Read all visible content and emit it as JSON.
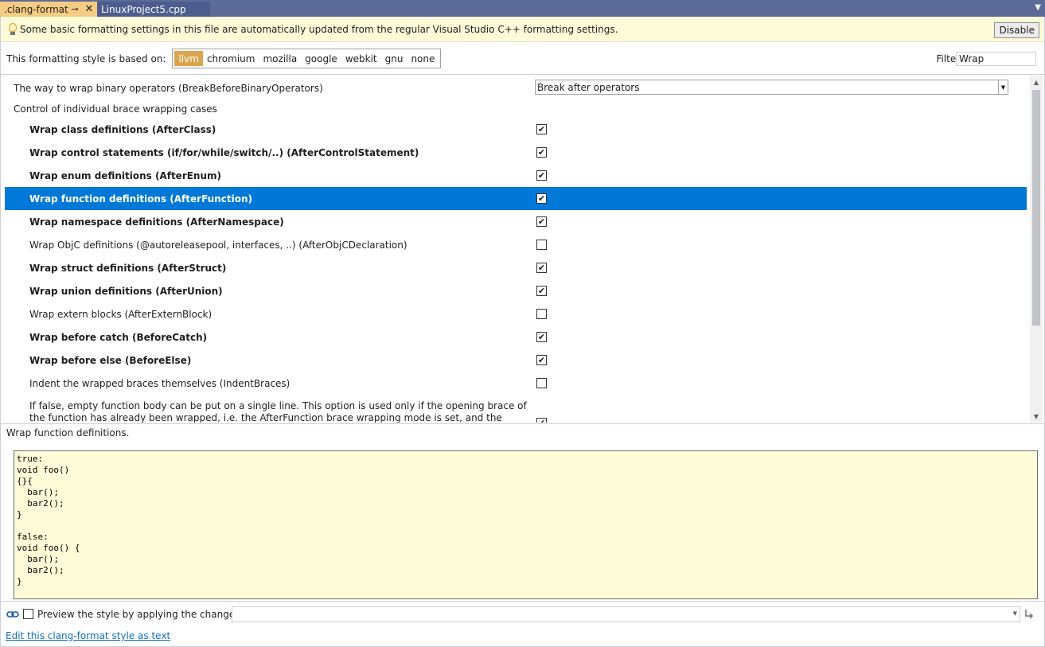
{
  "tabs": {
    "active_label": ".clang-format",
    "inactive_label": "LinuxProject5.cpp"
  },
  "infobar": {
    "message": "Some basic formatting settings in this file are automatically updated from the regular Visual Studio C++ formatting settings.",
    "disable_label": "Disable"
  },
  "basedon": {
    "label": "This formatting style is based on:",
    "styles": [
      "llvm",
      "chromium",
      "mozilla",
      "google",
      "webkit",
      "gnu",
      "none"
    ],
    "selected": "llvm",
    "filter_label": "Filter:",
    "filter_value": "Wrap"
  },
  "settings": {
    "binary_ops_label": "The way to wrap binary operators (BreakBeforeBinaryOperators)",
    "binary_ops_value": "Break after operators",
    "brace_group_label": "Control of individual brace wrapping cases",
    "items": [
      {
        "label": "Wrap class definitions (AfterClass)",
        "checked": true,
        "bold": true
      },
      {
        "label": "Wrap control statements (if/for/while/switch/..) (AfterControlStatement)",
        "checked": true,
        "bold": true
      },
      {
        "label": "Wrap enum definitions (AfterEnum)",
        "checked": true,
        "bold": true
      },
      {
        "label": "Wrap function definitions (AfterFunction)",
        "checked": true,
        "bold": true,
        "selected": true
      },
      {
        "label": "Wrap namespace definitions (AfterNamespace)",
        "checked": true,
        "bold": true
      },
      {
        "label": "Wrap ObjC definitions (@autoreleasepool, interfaces, ..) (AfterObjCDeclaration)",
        "checked": false,
        "bold": false
      },
      {
        "label": "Wrap struct definitions (AfterStruct)",
        "checked": true,
        "bold": true
      },
      {
        "label": "Wrap union definitions (AfterUnion)",
        "checked": true,
        "bold": true
      },
      {
        "label": "Wrap extern blocks (AfterExternBlock)",
        "checked": false,
        "bold": false
      },
      {
        "label": "Wrap before catch (BeforeCatch)",
        "checked": true,
        "bold": true
      },
      {
        "label": "Wrap before else (BeforeElse)",
        "checked": true,
        "bold": true
      },
      {
        "label": "Indent the wrapped braces themselves (IndentBraces)",
        "checked": false,
        "bold": false
      }
    ],
    "multiline_text": "If false, empty function body can be put on a single line. This option is used only if the opening brace of the function has already been wrapped, i.e. the AfterFunction brace wrapping mode is set, and the function could/should not be"
  },
  "description": {
    "text": "Wrap function definitions.",
    "code": "true:\nvoid foo()\n{}{\n  bar();\n  bar2();\n}\n\nfalse:\nvoid foo() {\n  bar();\n  bar2();\n}"
  },
  "bottom": {
    "preview_label": "Preview the style by applying the changes to",
    "edit_link": "Edit this clang-format style as text"
  }
}
